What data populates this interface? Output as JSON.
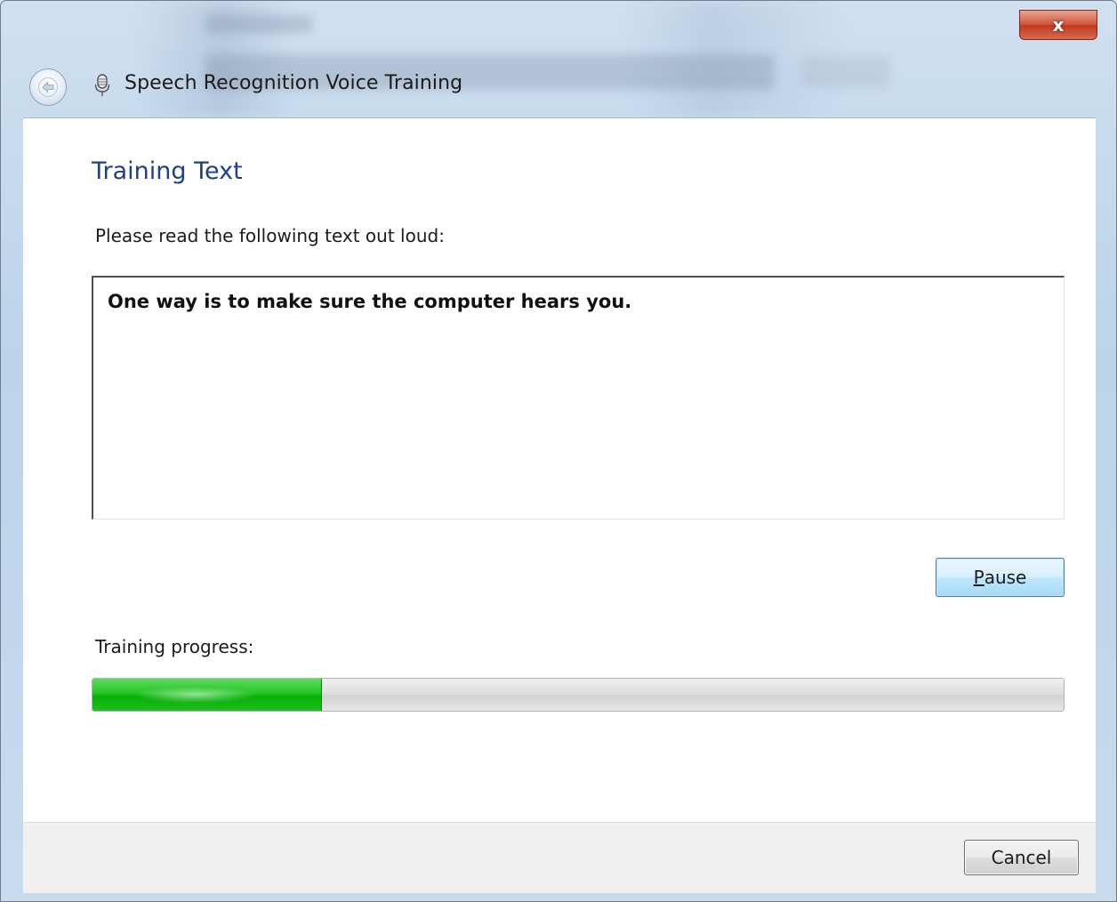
{
  "window": {
    "title": "Speech Recognition Voice Training",
    "close_label": "x",
    "background_title_hint": "Language"
  },
  "page": {
    "heading": "Training Text",
    "instruction": "Please read the following text out loud:",
    "training_text": "One way is to make sure the computer hears you.",
    "pause_label": "Pause",
    "pause_accesskey": "P",
    "progress_label": "Training progress:",
    "progress_fraction": 0.235
  },
  "footer": {
    "cancel_label": "Cancel"
  },
  "colors": {
    "heading": "#1e3f8a",
    "progress_fill": "#06b006",
    "close_button": "#c33a1f",
    "content_background": "#ffffff",
    "footer_background": "#f0f0f0"
  },
  "icons": {
    "back": "back-arrow-icon",
    "title": "microphone-icon",
    "close": "close-icon"
  }
}
